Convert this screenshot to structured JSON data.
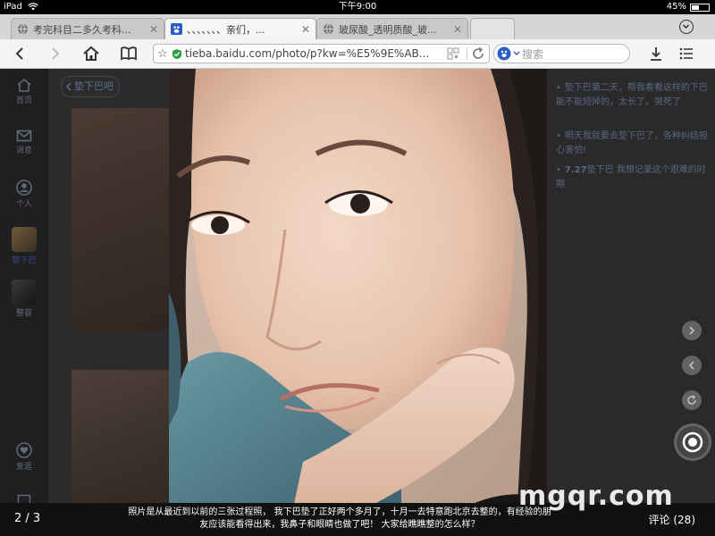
{
  "status_bar": {
    "device": "iPad",
    "time": "下午9:00",
    "battery_percent": "45%",
    "battery_level": 0.45
  },
  "tabs": [
    {
      "label": "考完科目二多久考科...",
      "icon": "globe-icon",
      "active": false
    },
    {
      "label": "、、、、、、、亲们，...",
      "icon": "baidu-paw-icon",
      "active": true
    },
    {
      "label": "玻尿酸_透明质酸_玻...",
      "icon": "globe-icon",
      "active": false
    }
  ],
  "toolbar": {
    "url": "tieba.baidu.com/photo/p?kw=%E5%9E%AB...",
    "search_placeholder": "搜索"
  },
  "sidebar": {
    "items": [
      {
        "label": "首页",
        "icon": "home-icon"
      },
      {
        "label": "消息",
        "icon": "mail-icon"
      },
      {
        "label": "个人",
        "icon": "person-icon"
      },
      {
        "label": "垫下巴",
        "icon": "forum-avatar"
      },
      {
        "label": "整容",
        "icon": "forum-avatar"
      },
      {
        "label": "爱逛",
        "icon": "love-icon"
      }
    ]
  },
  "background_page": {
    "back_label": "垫下巴吧"
  },
  "right_panel": {
    "items": [
      {
        "text": "垫下巴第二天，帮我看看这样的下巴能不能短掉的，太长了。哭死了"
      },
      {
        "text": "明天我就要去垫下巴了，各种纠结担心害怕!"
      },
      {
        "bold": "7.27",
        "text": "垫下巴 我想记录这个艰难的时期"
      }
    ]
  },
  "viewer": {
    "counter": "2 / 3",
    "caption": "照片是从最近到以前的三张过程照， 我下巴垫了正好两个多月了，十月一去特意跑北京去整的，有经验的朋友应该能看得出来，我鼻子和眼睛也做了吧！ 大家给瞧瞧整的怎么样？",
    "comments_label": "评论 (28)",
    "watermark": "mgqr.com"
  },
  "colors": {
    "accent_green": "#2e9e3e",
    "link_blue": "#5a6782"
  }
}
